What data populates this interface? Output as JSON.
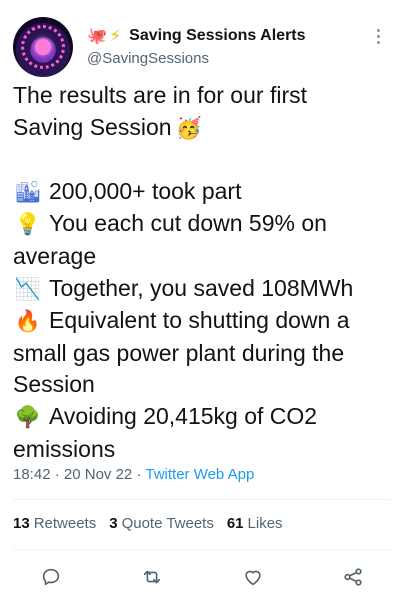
{
  "author": {
    "display_name": "Saving Sessions Alerts",
    "handle": "@SavingSessions",
    "name_emojis": [
      "🐙",
      "⚡"
    ]
  },
  "tweet": {
    "lines": [
      {
        "icon": "",
        "text": "The results are in for our first"
      },
      {
        "icon": "",
        "text": "Saving Session",
        "suffix_icon": "🥳"
      },
      {
        "icon": "",
        "text": ""
      },
      {
        "icon": "🏙",
        "text": "200,000+ took part"
      },
      {
        "icon": "💡",
        "text": "You each cut down 59% on"
      },
      {
        "icon": "",
        "text": "average"
      },
      {
        "icon": "📉",
        "text": "Together, you saved 108MWh"
      },
      {
        "icon": "🔥",
        "text": "Equivalent to shutting down a"
      },
      {
        "icon": "",
        "text": "small gas power plant during the"
      },
      {
        "icon": "",
        "text": "Session"
      },
      {
        "icon": "🌳",
        "text": "Avoiding 20,415kg of CO2"
      },
      {
        "icon": "",
        "text": "emissions"
      }
    ],
    "time": "18:42",
    "date": "20 Nov 22",
    "source": "Twitter Web App"
  },
  "stats": {
    "retweets_count": "13",
    "retweets_label": "Retweets",
    "quotes_count": "3",
    "quotes_label": "Quote Tweets",
    "likes_count": "61",
    "likes_label": "Likes"
  },
  "colors": {
    "accent": "#1d9bf0",
    "secondary_text": "#536471",
    "primary_text": "#0f1419",
    "divider": "#eff3f4"
  }
}
